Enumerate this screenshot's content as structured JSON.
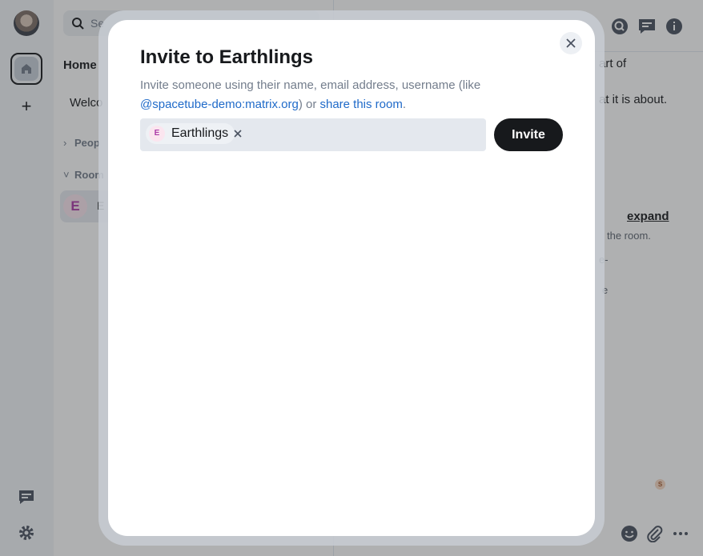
{
  "sidebar": {
    "avatar_icon": "user-avatar",
    "home_icon": "home-icon",
    "create_space_label": "+",
    "threads_icon": "threads-icon",
    "settings_icon": "gear-icon"
  },
  "room_list": {
    "search_placeholder": "Se",
    "home_title": "Home",
    "welcome_text": "Welco",
    "sections": {
      "people": "Peop",
      "rooms": "Room"
    },
    "room": {
      "avatar_letter": "E",
      "name": "E"
    }
  },
  "timeline": {
    "line1": "art of",
    "line2": "at it is about.",
    "expand_label": "expand",
    "small1": "the room.",
    "small2": "e-",
    "small3": "e",
    "mini_avatar_letter": "S"
  },
  "dialog": {
    "title": "Invite to Earthlings",
    "description_prefix": "Invite someone using their name, email address, username (like ",
    "description_link_user": "@spacetube-demo:matrix.org",
    "description_middle": ") or ",
    "description_link_share": "share this room",
    "description_suffix": ".",
    "pill": {
      "avatar_letter": "E",
      "name": "Earthlings"
    },
    "invite_button": "Invite"
  },
  "colors": {
    "accent_link": "#1f6ac9",
    "primary_button": "#17191c",
    "room_avatar_bg": "#fbe5ef",
    "room_avatar_fg": "#ac3ba8"
  }
}
